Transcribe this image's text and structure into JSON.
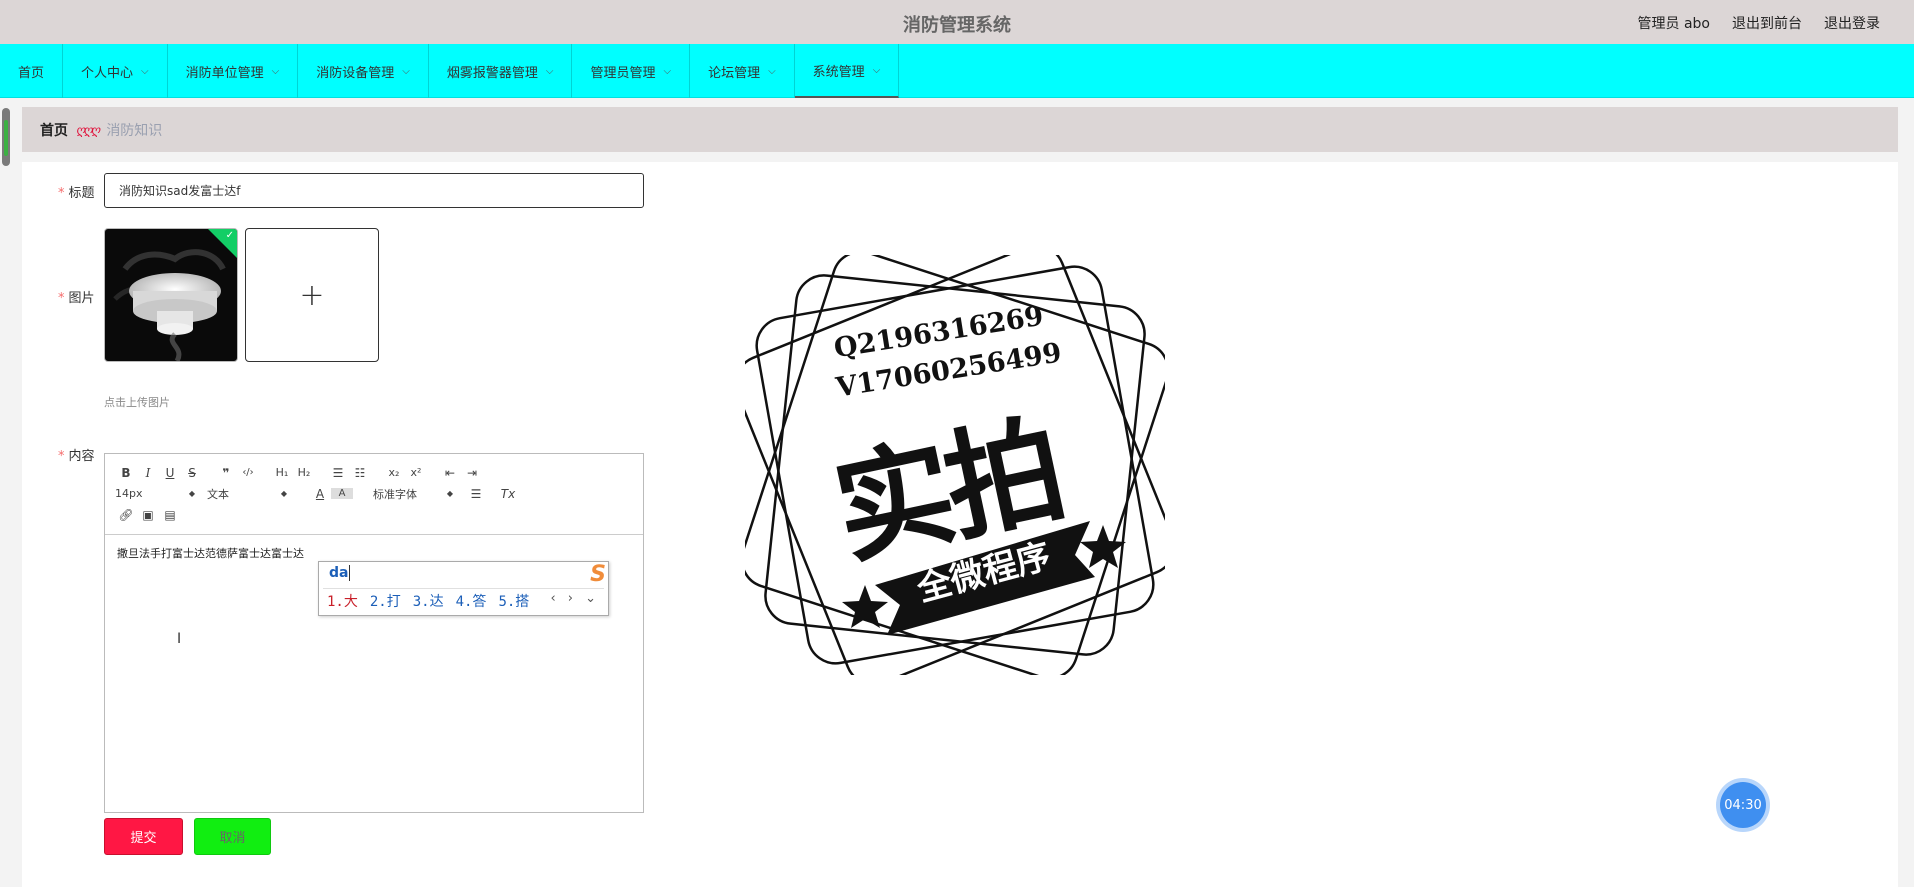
{
  "header": {
    "title": "消防管理系统",
    "user_label": "管理员 abo",
    "to_frontend": "退出到前台",
    "logout": "退出登录"
  },
  "nav": {
    "items": [
      {
        "label": "首页"
      },
      {
        "label": "个人中心"
      },
      {
        "label": "消防单位管理"
      },
      {
        "label": "消防设备管理"
      },
      {
        "label": "烟雾报警器管理"
      },
      {
        "label": "管理员管理"
      },
      {
        "label": "论坛管理"
      },
      {
        "label": "系统管理"
      }
    ],
    "active_index": 7
  },
  "breadcrumb": {
    "home": "首页",
    "separator": "ღღღ",
    "current": "消防知识"
  },
  "form": {
    "title_label": "标题",
    "title_value": "消防知识sad发富士达f",
    "image_label": "图片",
    "upload_plus": "+",
    "upload_tip": "点击上传图片",
    "content_label": "内容",
    "editor": {
      "font_size": "14px",
      "block_format": "文本",
      "font_family": "标准字体",
      "body_text": "撒旦法手打富士达范德萨富士达富士达"
    },
    "submit_label": "提交",
    "cancel_label": "取消"
  },
  "ime": {
    "pinyin": "da",
    "logo": "S",
    "candidates": [
      "1.大",
      "2.打",
      "3.达",
      "4.答",
      "5.搭"
    ],
    "pager": "‹ › ⌄"
  },
  "watermark": {
    "line1": "Q2196316269",
    "line2": "V17060256499",
    "big": "实拍",
    "banner": "全微程序"
  },
  "timer": "04:30",
  "colors": {
    "nav_bg": "#00ffff",
    "submit_bg": "#ff1744",
    "cancel_bg": "#11ee11",
    "header_bg": "#dcd6d6"
  }
}
